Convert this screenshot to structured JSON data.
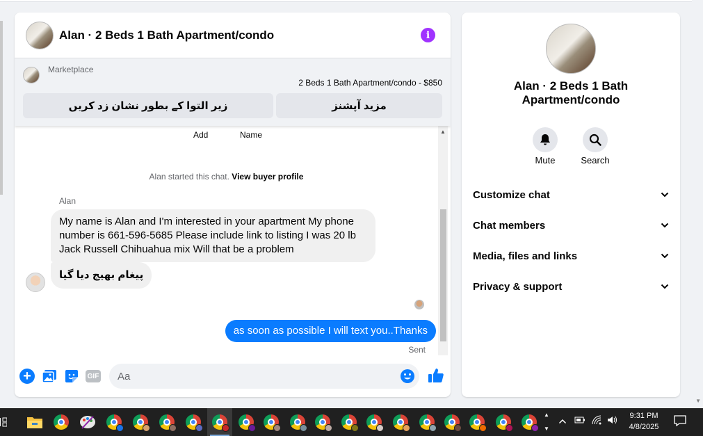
{
  "chat": {
    "title": "Alan · 2 Beds 1 Bath Apartment/condo",
    "marketplace_label": "Marketplace",
    "listing": "2 Beds 1 Bath Apartment/condo - $850",
    "more_options_label": "مزید آپشنز",
    "mark_pending_label": "زیر التوا کے بطور نشان زد کریں",
    "profile_actions": [
      "Add",
      "Name"
    ],
    "started_text": "Alan started this chat.",
    "view_profile_label": "View buyer profile",
    "sender_name": "Alan",
    "messages": [
      {
        "from": "Alan",
        "text": "My name is Alan and I'm interested in your apartment My phone number is 661-596-5685 Please include link to listing I was 20 lb Jack Russell Chihuahua mix Will that be a problem"
      },
      {
        "from": "Alan",
        "text": "پیغام بھیج دیا گیا"
      },
      {
        "from": "me",
        "text": "as soon as possible I will text you..Thanks"
      }
    ],
    "sent_status": "Sent",
    "composer_placeholder": "Aa",
    "gif_label": "GIF"
  },
  "sidebar": {
    "name": "Alan · 2 Beds 1 Bath Apartment/condo",
    "actions": [
      {
        "label": "Mute",
        "icon": "bell-icon"
      },
      {
        "label": "Search",
        "icon": "search-icon"
      }
    ],
    "sections": [
      "Customize chat",
      "Chat members",
      "Media, files and links",
      "Privacy & support"
    ]
  },
  "taskbar": {
    "time": "9:31 PM",
    "date": "4/8/2025"
  },
  "colors": {
    "accent_blue": "#0a7cff",
    "info_purple": "#a033ff",
    "taskbar_bg": "#202020"
  }
}
